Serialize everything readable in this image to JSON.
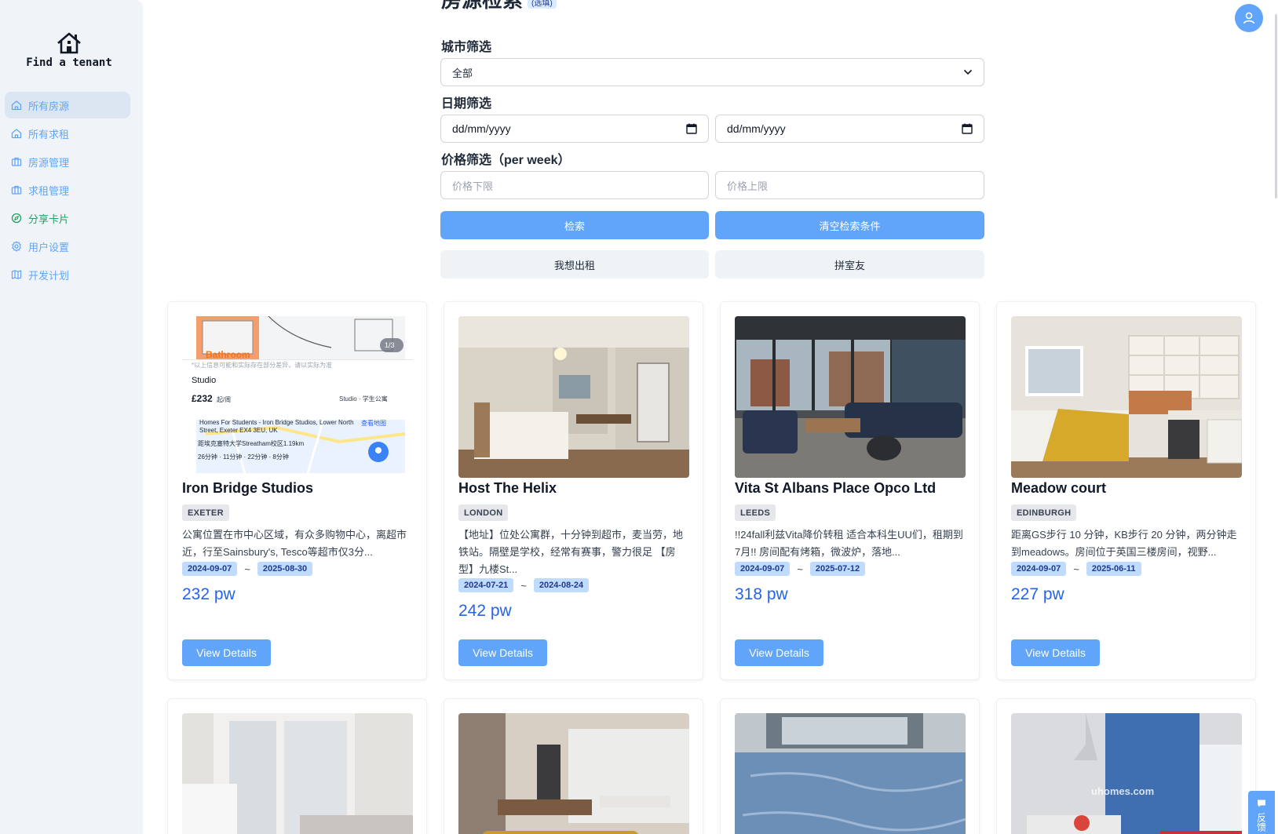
{
  "app": {
    "logo_text": "Find a tenant"
  },
  "sidebar": {
    "items": [
      {
        "label": "所有房源",
        "icon": "home-icon",
        "active": true
      },
      {
        "label": "所有求租",
        "icon": "home-icon"
      },
      {
        "label": "房源管理",
        "icon": "briefcase-icon"
      },
      {
        "label": "求租管理",
        "icon": "briefcase-icon"
      },
      {
        "label": "分享卡片",
        "icon": "compass-icon"
      },
      {
        "label": "用户设置",
        "icon": "gear-icon"
      },
      {
        "label": "开发计划",
        "icon": "map-icon"
      }
    ]
  },
  "search": {
    "title": "房源检索",
    "title_badge": "(选填)",
    "city_label": "城市筛选",
    "city_value": "全部",
    "date_label": "日期筛选",
    "date_start": "dd/mm/yyyy",
    "date_end": "dd/mm/yyyy",
    "price_label": "价格筛选（per week）",
    "price_min_placeholder": "价格下限",
    "price_max_placeholder": "价格上限",
    "search_button": "检索",
    "clear_button": "清空检索条件",
    "rent_out_button": "我想出租",
    "roommate_button": "拼室友"
  },
  "listings": [
    {
      "title": "Iron Bridge Studios",
      "city": "EXETER",
      "description": "公寓位置在市中心区域，有众多购物中心，离超市近，行至Sainsbury's, Tesco等超市仅3分...",
      "date_from": "2024-09-07",
      "date_to": "2025-08-30",
      "price": "232 pw",
      "button": "View Details",
      "image": {
        "counter": "1/3",
        "room_label": "Bathroom",
        "disclaimer": "*以上信息可能和实际存在部分差异，请以实际为准",
        "type": "Studio",
        "price": "£232",
        "price_unit": "起/周",
        "category": "Studio · 学生公寓",
        "address": "Homes For Students - Iron Bridge Studios, Lower North Street, Exeter EX4 3EU, UK",
        "map_link": "查看地图",
        "distance": "距埃克塞特大学Streatham校区1.19km",
        "travel": "26分钟 · 11分钟 · 22分钟 · 8分钟"
      }
    },
    {
      "title": "Host The Helix",
      "city": "LONDON",
      "description": "【地址】位处公寓群，十分钟到超市，麦当劳，地铁站。隔壁是学校，经常有赛事，警力很足 【房型】九楼St...",
      "date_from": "2024-07-21",
      "date_to": "2024-08-24",
      "price": "242 pw",
      "button": "View Details"
    },
    {
      "title": "Vita St Albans Place Opco Ltd",
      "city": "LEEDS",
      "description": "!!24fall利兹Vita降价转租 适合本科生UU们，租期到7月!! 房间配有烤箱，微波炉，落地...",
      "date_from": "2024-09-07",
      "date_to": "2025-07-12",
      "price": "318 pw",
      "button": "View Details"
    },
    {
      "title": "Meadow court",
      "city": "EDINBURGH",
      "description": "距离GS步行 10 分钟，KB步行 20 分钟，两分钟走到meadows。房间位于英国三楼房间，视野...",
      "date_from": "2024-09-07",
      "date_to": "2025-06-11",
      "price": "227 pw",
      "button": "View Details"
    }
  ],
  "second_row": {
    "watermark": "uhomes.com"
  },
  "feedback": {
    "label": "反馈"
  }
}
